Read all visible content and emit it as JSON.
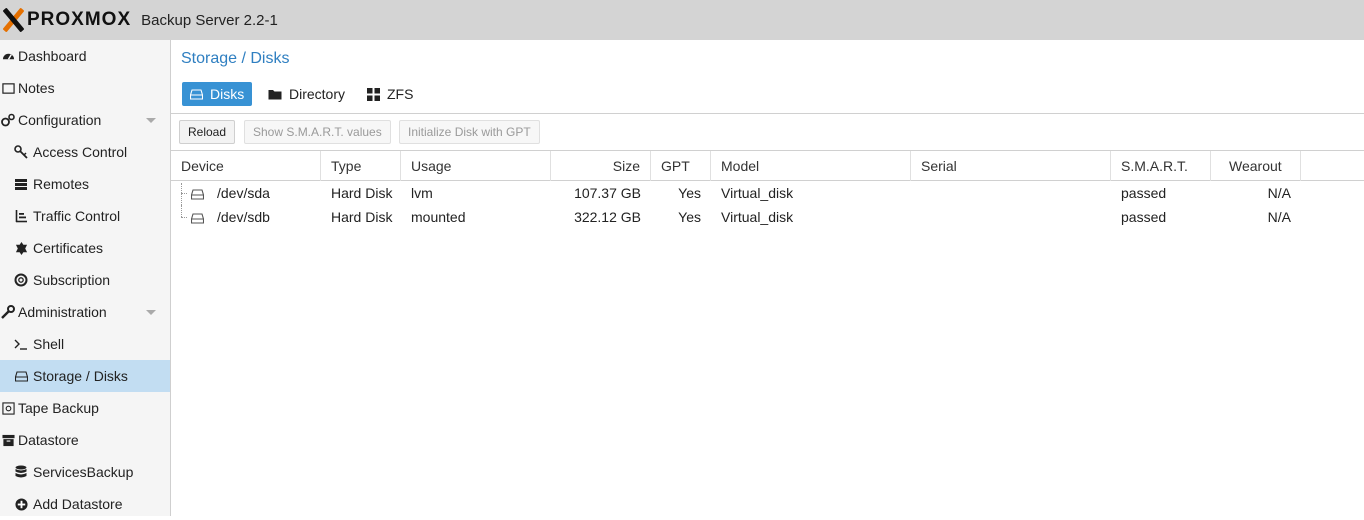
{
  "header": {
    "logo_text": "PROXMOX",
    "app_title": "Backup Server 2.2-1"
  },
  "sidebar": {
    "items": [
      {
        "label": "Dashboard",
        "icon": "dashboard-icon"
      },
      {
        "label": "Notes",
        "icon": "notes-icon"
      },
      {
        "label": "Configuration",
        "icon": "gears-icon"
      },
      {
        "label": "Access Control",
        "icon": "key-icon"
      },
      {
        "label": "Remotes",
        "icon": "server-icon"
      },
      {
        "label": "Traffic Control",
        "icon": "chart-icon"
      },
      {
        "label": "Certificates",
        "icon": "certificate-icon"
      },
      {
        "label": "Subscription",
        "icon": "support-icon"
      },
      {
        "label": "Administration",
        "icon": "wrench-icon"
      },
      {
        "label": "Shell",
        "icon": "terminal-icon"
      },
      {
        "label": "Storage / Disks",
        "icon": "hdd-icon"
      },
      {
        "label": "Tape Backup",
        "icon": "tape-icon"
      },
      {
        "label": "Datastore",
        "icon": "archive-icon"
      },
      {
        "label": "ServicesBackup",
        "icon": "database-icon"
      },
      {
        "label": "Add Datastore",
        "icon": "plus-circle-icon"
      }
    ]
  },
  "main": {
    "breadcrumb": "Storage / Disks",
    "tabs": [
      {
        "label": "Disks",
        "icon": "hdd-icon"
      },
      {
        "label": "Directory",
        "icon": "folder-icon"
      },
      {
        "label": "ZFS",
        "icon": "th-large-icon"
      }
    ],
    "toolbar": {
      "reload": "Reload",
      "smart": "Show S.M.A.R.T. values",
      "init_gpt": "Initialize Disk with GPT"
    },
    "columns": [
      "Device",
      "Type",
      "Usage",
      "Size",
      "GPT",
      "Model",
      "Serial",
      "S.M.A.R.T.",
      "Wearout"
    ],
    "rows": [
      {
        "device": "/dev/sda",
        "type": "Hard Disk",
        "usage": "lvm",
        "size": "107.37 GB",
        "gpt": "Yes",
        "model": "Virtual_disk",
        "serial": "",
        "smart": "passed",
        "wearout": "N/A"
      },
      {
        "device": "/dev/sdb",
        "type": "Hard Disk",
        "usage": "mounted",
        "size": "322.12 GB",
        "gpt": "Yes",
        "model": "Virtual_disk",
        "serial": "",
        "smart": "passed",
        "wearout": "N/A"
      }
    ]
  },
  "colors": {
    "accent": "#3892d4",
    "brand_orange": "#e57000",
    "selected_nav": "#c2ddf2"
  }
}
